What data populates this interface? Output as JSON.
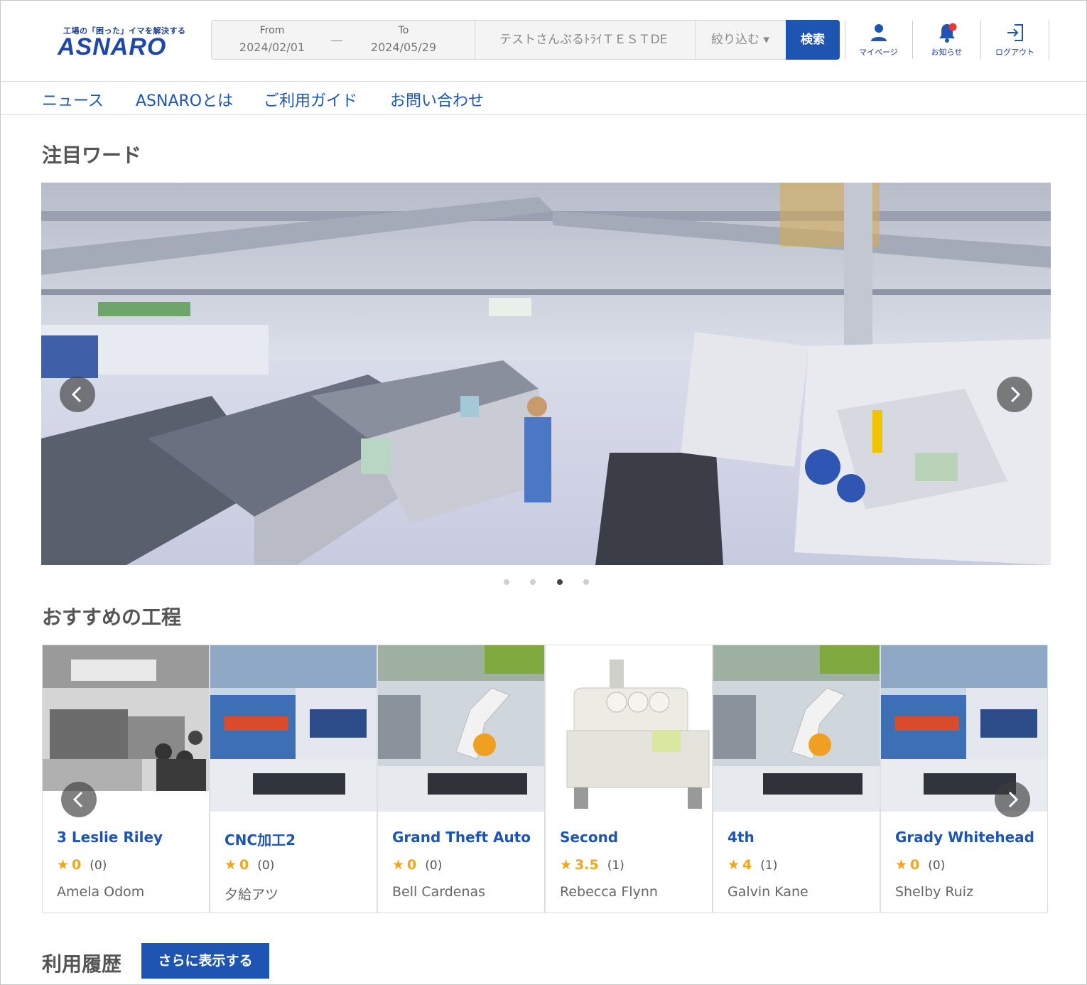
{
  "header": {
    "logo_tagline": "工場の「困った」イマを解決する",
    "logo_text": "ASNARO",
    "search": {
      "from_label": "From",
      "from_value": "2024/02/01",
      "to_label": "To",
      "to_value": "2024/05/29",
      "keyword_value": "テストさんぷるﾄﾗｲＴＥＳＴDE",
      "filter_label": "絞り込む ▾",
      "search_button": "検索"
    },
    "icons": [
      {
        "label": "マイページ",
        "icon": "user-icon"
      },
      {
        "label": "お知らせ",
        "icon": "bell-icon"
      },
      {
        "label": "ログアウト",
        "icon": "logout-icon"
      }
    ]
  },
  "nav": [
    "ニュース",
    "ASNAROとは",
    "ご利用ガイド",
    "お問い合わせ"
  ],
  "featured": {
    "title": "注目ワード",
    "carousel": {
      "active_index": 2,
      "total": 4
    }
  },
  "recommended": {
    "title": "おすすめの工程",
    "cards": [
      {
        "title": "3 Leslie Riley",
        "score": "0",
        "count": "(0)",
        "author": "Amela Odom"
      },
      {
        "title": "CNC加工2",
        "score": "0",
        "count": "(0)",
        "author": "夕給アツ"
      },
      {
        "title": "Grand Theft Auto",
        "score": "0",
        "count": "(0)",
        "author": "Bell Cardenas"
      },
      {
        "title": "Second",
        "score": "3.5",
        "count": "(1)",
        "author": "Rebecca Flynn"
      },
      {
        "title": "4th",
        "score": "4",
        "count": "(1)",
        "author": "Galvin Kane"
      },
      {
        "title": "Grady Whitehead",
        "score": "0",
        "count": "(0)",
        "author": "Shelby Ruiz"
      }
    ]
  },
  "history": {
    "title": "利用履歴",
    "more_button": "さらに表示する"
  },
  "colors": {
    "brand": "#1e55b3",
    "star": "#f2a51a",
    "notification": "#e53935"
  }
}
